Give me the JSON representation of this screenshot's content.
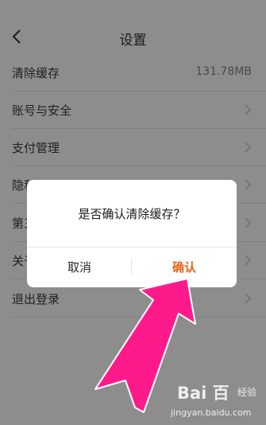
{
  "header": {
    "title": "设置"
  },
  "settings_items": [
    {
      "label": "清除缓存",
      "value": "131.78MB"
    },
    {
      "label": "账号与安全"
    },
    {
      "label": "支付管理"
    },
    {
      "label": "隐私"
    },
    {
      "label": "第三"
    },
    {
      "label": "关于"
    },
    {
      "label": "退出登录"
    }
  ],
  "dialog": {
    "message": "是否确认清除缓存？",
    "cancel_label": "取消",
    "confirm_label": "确认"
  },
  "watermark": {
    "logo": "Bai 百",
    "brand": "经验",
    "url": "jingyan.baidu.com"
  },
  "colors": {
    "accent": "#e8641a",
    "annotation_arrow": "#ff1493",
    "overlay": "#8d8d8d"
  }
}
